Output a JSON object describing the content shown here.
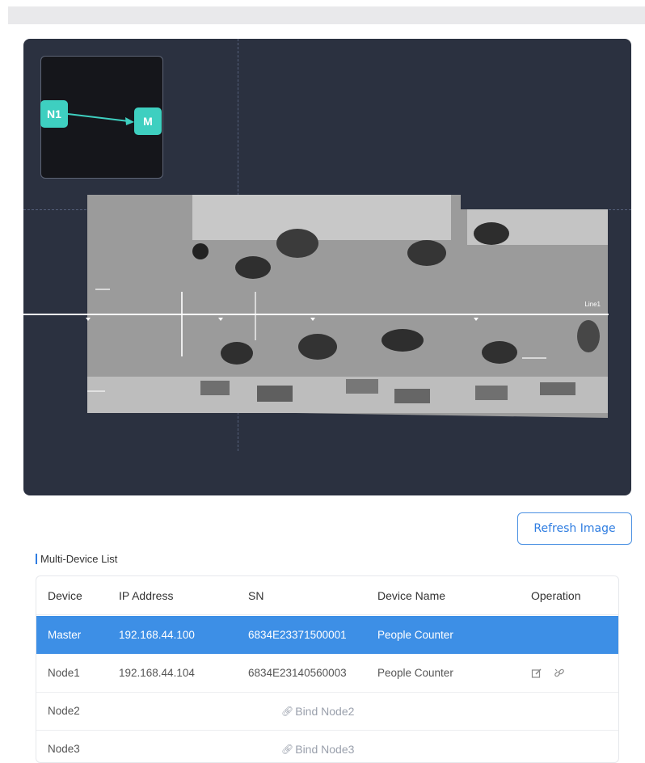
{
  "stage": {
    "minimap": {
      "node_a": "N1",
      "node_b": "M"
    },
    "line_label": "Line1"
  },
  "actions": {
    "refresh_label": "Refresh Image"
  },
  "list": {
    "title": "Multi-Device List",
    "columns": [
      "Device",
      "IP Address",
      "SN",
      "Device Name",
      "Operation"
    ],
    "rows": [
      {
        "device": "Master",
        "ip": "192.168.44.100",
        "sn": "6834E23371500001",
        "name": "People Counter",
        "selected": true
      },
      {
        "device": "Node1",
        "ip": "192.168.44.104",
        "sn": "6834E23140560003",
        "name": "People Counter",
        "operations": [
          "edit-icon",
          "unlink-icon"
        ]
      },
      {
        "device": "Node2",
        "bind_label": "Bind Node2"
      },
      {
        "device": "Node3",
        "bind_label": "Bind Node3"
      }
    ]
  },
  "colors": {
    "accent": "#3d8fe6",
    "stage_bg": "#2b3140",
    "node": "#3ecfc0"
  }
}
